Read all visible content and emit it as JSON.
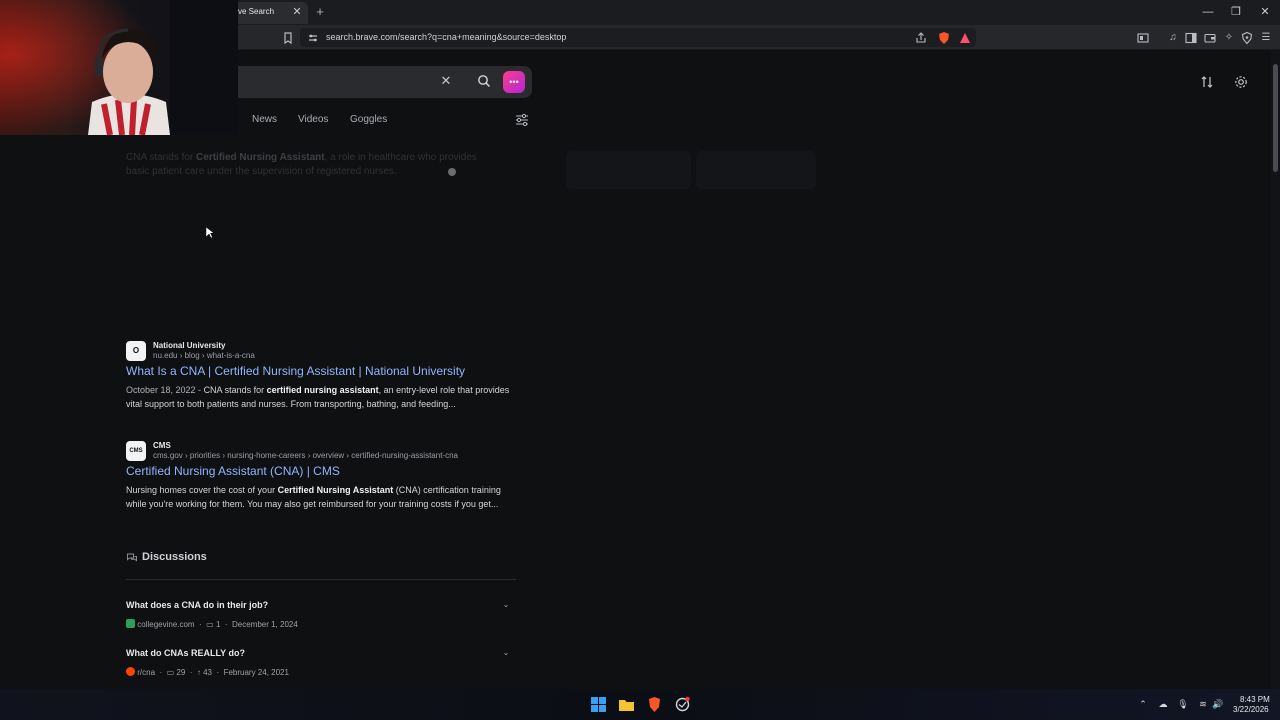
{
  "browser": {
    "tab_title": "ve Search",
    "url": "search.brave.com/search?q=cna+meaning&source=desktop",
    "accent": "#8fb6ff"
  },
  "search": {
    "query": "",
    "tabs": [
      "News",
      "Videos",
      "Goggles"
    ]
  },
  "summary": {
    "lead": "CNA stands for",
    "bold": "Certified Nursing Assistant",
    "rest": ", a role in healthcare who provides basic patient care under the supervision of registered nurses."
  },
  "results": [
    {
      "site_name": "National University",
      "favicon_text": "O",
      "path": "nu.edu › blog › what-is-a-cna",
      "title": "What Is a CNA | Certified Nursing Assistant | National University",
      "date": "October 18, 2022 -",
      "desc_pre": "CNA stands for",
      "desc_bold": "certified nursing assistant",
      "desc_post": ", an entry-level role that provides vital support to both patients and nurses. From transporting, bathing, and feeding..."
    },
    {
      "site_name": "CMS",
      "favicon_text": "CMS",
      "path": "cms.gov › priorities › nursing-home-careers › overview › certified-nursing-assistant-cna",
      "title": "Certified Nursing Assistant (CNA) | CMS",
      "desc_pre": "Nursing homes cover the cost of your",
      "desc_bold": "Certified Nursing Assistant",
      "desc_post": "(CNA) certification training while you're working for them. You may also get reimbursed for your training costs if you get..."
    }
  ],
  "discussions": {
    "heading": "Discussions",
    "items": [
      {
        "question": "What does a CNA do in their job?",
        "source": "collegevine.com",
        "comments": "1",
        "date": "December 1, 2024"
      },
      {
        "question": "What do CNAs REALLY do?",
        "source": "r/cna",
        "comments": "29",
        "upvotes": "43",
        "date": "February 24, 2021"
      }
    ]
  },
  "taskbar": {
    "time": "8:43 PM",
    "date": "3/22/2026"
  }
}
